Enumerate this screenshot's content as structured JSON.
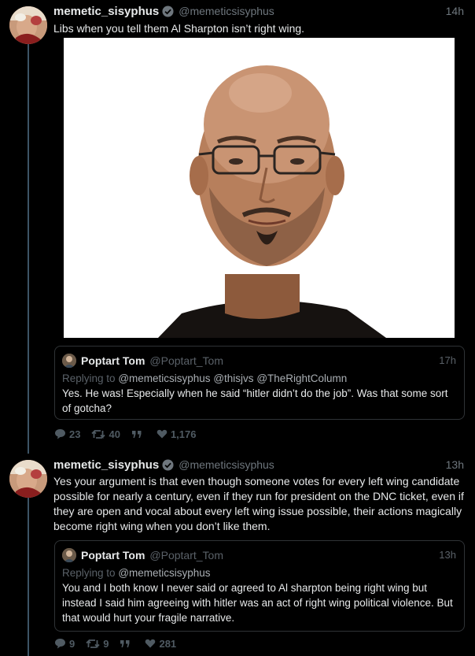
{
  "tweets": [
    {
      "author_name": "memetic_sisyphus",
      "author_handle": "@memeticsisyphus",
      "time": "14h",
      "text": "Libs when you tell them Al Sharpton isn’t right wing.",
      "quote": {
        "author_name": "Poptart Tom",
        "author_handle": "@Poptart_Tom",
        "time": "17h",
        "replying_prefix": "Replying to",
        "replying_to": [
          "@memeticsisyphus",
          "@thisjvs",
          "@TheRightColumn"
        ],
        "text": "Yes. He was! Especially when he said “hitler didn’t do the job”. Was that some sort of gotcha?"
      },
      "stats": {
        "replies": "23",
        "retweets": "40",
        "likes": "1,176"
      }
    },
    {
      "author_name": "memetic_sisyphus",
      "author_handle": "@memeticsisyphus",
      "time": "13h",
      "text": "Yes your argument is that even though someone votes for every left wing candidate possible for nearly a century, even if they run for president on the DNC ticket, even if they are open and vocal about every left wing issue possible, their actions magically become right wing when you don’t like them.",
      "quote": {
        "author_name": "Poptart Tom",
        "author_handle": "@Poptart_Tom",
        "time": "13h",
        "replying_prefix": "Replying to",
        "replying_to": [
          "@memeticsisyphus"
        ],
        "text": "You and I both know I never said or agreed to Al sharpton being right wing but instead I said him agreeing with hitler was an act of right wing political violence. But that would hurt your fragile narrative."
      },
      "stats": {
        "replies": "9",
        "retweets": "9",
        "likes": "281"
      }
    }
  ],
  "icons": {
    "verified": "verified-badge-icon",
    "reply": "reply-bubble-icon",
    "retweet": "retweet-arrows-icon",
    "quote": "quote-marks-icon",
    "like": "heart-icon"
  },
  "colors": {
    "background": "#000000",
    "thread_line": "#3d5466",
    "secondary_text": "#6e767d",
    "verified": "#6e767d"
  }
}
